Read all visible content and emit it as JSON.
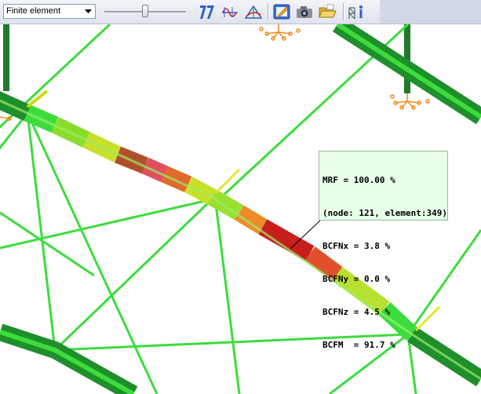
{
  "toolbar": {
    "view_mode_select": {
      "selected": "Finite element"
    },
    "slider": {
      "value_fraction": 0.5
    },
    "icons": [
      "section-sizes-icon",
      "diagram-results-icon",
      "deformation-icon",
      "edit-result-icon",
      "camera-icon",
      "open-folder-icon",
      "structure-info-icon"
    ]
  },
  "tooltip": {
    "line1": "MRF = 100.00 %",
    "line2": "(node: 121, element:349)",
    "line3": "BCFNx = 3.8 %",
    "line4": "BCFNy = 0.0 %",
    "line5": "BCFNz = 4.5 %",
    "line6": "BCFM  = 91.7 %"
  },
  "colors": {
    "member_green": "#2ecc2e",
    "member_dark": "#1a8a1a",
    "support_orange": "#f08a1c",
    "critical_red": "#c81e1e",
    "tooltip_bg": "#e8ffe8"
  }
}
